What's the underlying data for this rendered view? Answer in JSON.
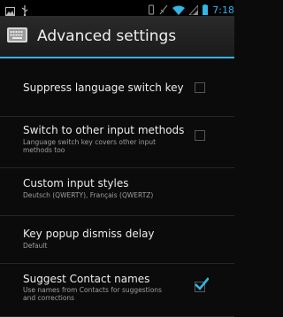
{
  "status_bar": {
    "time": "7:18",
    "icons": [
      "screenshot-icon",
      "usb-icon",
      "vibrate-icon",
      "no-signal-icon",
      "wifi-icon",
      "cell-signal-icon",
      "battery-icon"
    ]
  },
  "action_bar": {
    "icon": "keyboard-icon",
    "title": "Advanced settings"
  },
  "preferences": [
    {
      "title": "Suppress language switch key",
      "summary": "",
      "checkbox": true,
      "checked": false
    },
    {
      "title": "Switch to other input methods",
      "summary": "Language switch key covers other input methods too",
      "checkbox": true,
      "checked": false
    },
    {
      "title": "Custom input styles",
      "summary": "Deutsch (QWERTY), Français (QWERTZ)",
      "checkbox": false
    },
    {
      "title": "Key popup dismiss delay",
      "summary": "Default",
      "checkbox": false
    },
    {
      "title": "Suggest Contact names",
      "summary": "Use names from Contacts for suggestions and corrections",
      "checkbox": true,
      "checked": true
    }
  ],
  "colors": {
    "accent": "#33b5e5",
    "background": "#0b0b0b"
  }
}
